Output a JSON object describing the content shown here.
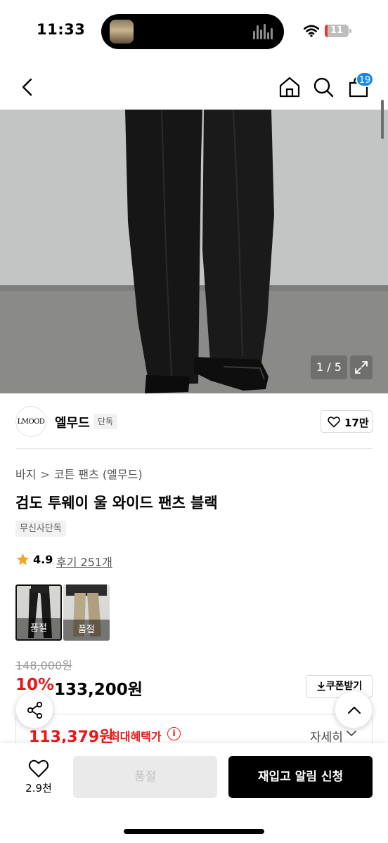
{
  "status_bar": {
    "time": "11:33",
    "battery": "11"
  },
  "nav": {
    "cart_count": "19"
  },
  "gallery": {
    "counter": "1 / 5"
  },
  "brand": {
    "logo_text": "LMOOD",
    "name": "엘무드",
    "tag": "단독",
    "likes": "17만"
  },
  "product": {
    "breadcrumb": [
      "바지",
      "코튼 팬츠 (엘무드)"
    ],
    "title": "검도 투웨이 울 와이드 팬츠 블랙",
    "exclusive_tag": "무신사단독",
    "rating": "4.9",
    "reviews": "후기 251개",
    "colors": [
      {
        "label": "품절",
        "selected": true
      },
      {
        "label": "품절",
        "selected": false
      }
    ]
  },
  "price": {
    "original": "148,000원",
    "discount": "10%",
    "sale": "133,200원",
    "coupon_label": "쿠폰받기",
    "max_benefit_price": "113,379원",
    "max_benefit_label": "최대혜택가",
    "detail_label": "자세히"
  },
  "bottom_bar": {
    "wish_count": "2.9천",
    "soldout_label": "품절",
    "restock_label": "재입고 알림 신청"
  },
  "colors": {
    "accent_red": "#e8181a",
    "badge_blue": "#1e88e5"
  }
}
